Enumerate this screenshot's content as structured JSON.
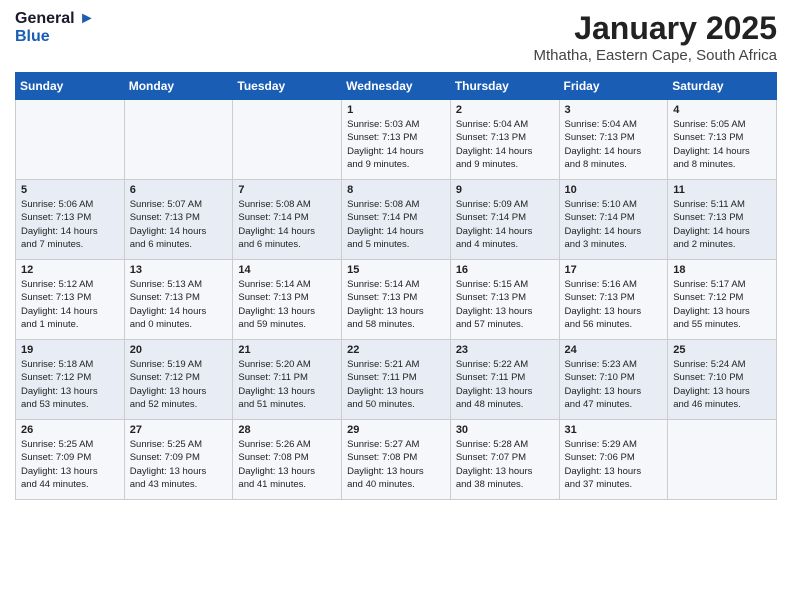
{
  "header": {
    "logo_line1": "General",
    "logo_line2": "Blue",
    "month": "January 2025",
    "location": "Mthatha, Eastern Cape, South Africa"
  },
  "weekdays": [
    "Sunday",
    "Monday",
    "Tuesday",
    "Wednesday",
    "Thursday",
    "Friday",
    "Saturday"
  ],
  "weeks": [
    [
      {
        "day": "",
        "info": ""
      },
      {
        "day": "",
        "info": ""
      },
      {
        "day": "",
        "info": ""
      },
      {
        "day": "1",
        "info": "Sunrise: 5:03 AM\nSunset: 7:13 PM\nDaylight: 14 hours\nand 9 minutes."
      },
      {
        "day": "2",
        "info": "Sunrise: 5:04 AM\nSunset: 7:13 PM\nDaylight: 14 hours\nand 9 minutes."
      },
      {
        "day": "3",
        "info": "Sunrise: 5:04 AM\nSunset: 7:13 PM\nDaylight: 14 hours\nand 8 minutes."
      },
      {
        "day": "4",
        "info": "Sunrise: 5:05 AM\nSunset: 7:13 PM\nDaylight: 14 hours\nand 8 minutes."
      }
    ],
    [
      {
        "day": "5",
        "info": "Sunrise: 5:06 AM\nSunset: 7:13 PM\nDaylight: 14 hours\nand 7 minutes."
      },
      {
        "day": "6",
        "info": "Sunrise: 5:07 AM\nSunset: 7:13 PM\nDaylight: 14 hours\nand 6 minutes."
      },
      {
        "day": "7",
        "info": "Sunrise: 5:08 AM\nSunset: 7:14 PM\nDaylight: 14 hours\nand 6 minutes."
      },
      {
        "day": "8",
        "info": "Sunrise: 5:08 AM\nSunset: 7:14 PM\nDaylight: 14 hours\nand 5 minutes."
      },
      {
        "day": "9",
        "info": "Sunrise: 5:09 AM\nSunset: 7:14 PM\nDaylight: 14 hours\nand 4 minutes."
      },
      {
        "day": "10",
        "info": "Sunrise: 5:10 AM\nSunset: 7:14 PM\nDaylight: 14 hours\nand 3 minutes."
      },
      {
        "day": "11",
        "info": "Sunrise: 5:11 AM\nSunset: 7:13 PM\nDaylight: 14 hours\nand 2 minutes."
      }
    ],
    [
      {
        "day": "12",
        "info": "Sunrise: 5:12 AM\nSunset: 7:13 PM\nDaylight: 14 hours\nand 1 minute."
      },
      {
        "day": "13",
        "info": "Sunrise: 5:13 AM\nSunset: 7:13 PM\nDaylight: 14 hours\nand 0 minutes."
      },
      {
        "day": "14",
        "info": "Sunrise: 5:14 AM\nSunset: 7:13 PM\nDaylight: 13 hours\nand 59 minutes."
      },
      {
        "day": "15",
        "info": "Sunrise: 5:14 AM\nSunset: 7:13 PM\nDaylight: 13 hours\nand 58 minutes."
      },
      {
        "day": "16",
        "info": "Sunrise: 5:15 AM\nSunset: 7:13 PM\nDaylight: 13 hours\nand 57 minutes."
      },
      {
        "day": "17",
        "info": "Sunrise: 5:16 AM\nSunset: 7:13 PM\nDaylight: 13 hours\nand 56 minutes."
      },
      {
        "day": "18",
        "info": "Sunrise: 5:17 AM\nSunset: 7:12 PM\nDaylight: 13 hours\nand 55 minutes."
      }
    ],
    [
      {
        "day": "19",
        "info": "Sunrise: 5:18 AM\nSunset: 7:12 PM\nDaylight: 13 hours\nand 53 minutes."
      },
      {
        "day": "20",
        "info": "Sunrise: 5:19 AM\nSunset: 7:12 PM\nDaylight: 13 hours\nand 52 minutes."
      },
      {
        "day": "21",
        "info": "Sunrise: 5:20 AM\nSunset: 7:11 PM\nDaylight: 13 hours\nand 51 minutes."
      },
      {
        "day": "22",
        "info": "Sunrise: 5:21 AM\nSunset: 7:11 PM\nDaylight: 13 hours\nand 50 minutes."
      },
      {
        "day": "23",
        "info": "Sunrise: 5:22 AM\nSunset: 7:11 PM\nDaylight: 13 hours\nand 48 minutes."
      },
      {
        "day": "24",
        "info": "Sunrise: 5:23 AM\nSunset: 7:10 PM\nDaylight: 13 hours\nand 47 minutes."
      },
      {
        "day": "25",
        "info": "Sunrise: 5:24 AM\nSunset: 7:10 PM\nDaylight: 13 hours\nand 46 minutes."
      }
    ],
    [
      {
        "day": "26",
        "info": "Sunrise: 5:25 AM\nSunset: 7:09 PM\nDaylight: 13 hours\nand 44 minutes."
      },
      {
        "day": "27",
        "info": "Sunrise: 5:25 AM\nSunset: 7:09 PM\nDaylight: 13 hours\nand 43 minutes."
      },
      {
        "day": "28",
        "info": "Sunrise: 5:26 AM\nSunset: 7:08 PM\nDaylight: 13 hours\nand 41 minutes."
      },
      {
        "day": "29",
        "info": "Sunrise: 5:27 AM\nSunset: 7:08 PM\nDaylight: 13 hours\nand 40 minutes."
      },
      {
        "day": "30",
        "info": "Sunrise: 5:28 AM\nSunset: 7:07 PM\nDaylight: 13 hours\nand 38 minutes."
      },
      {
        "day": "31",
        "info": "Sunrise: 5:29 AM\nSunset: 7:06 PM\nDaylight: 13 hours\nand 37 minutes."
      },
      {
        "day": "",
        "info": ""
      }
    ]
  ]
}
